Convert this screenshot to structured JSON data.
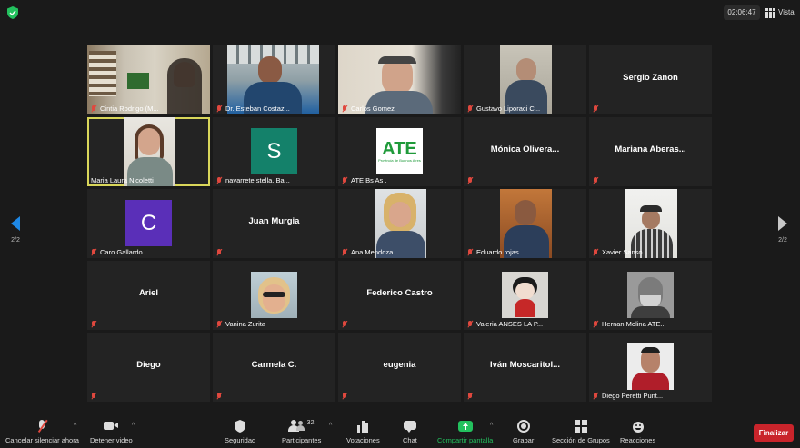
{
  "topbar": {
    "timer": "02:06:47",
    "view_label": "Vista"
  },
  "pager": {
    "left_page": "2/2",
    "right_page": "2/2"
  },
  "participants": [
    {
      "name": "Cintia Rodrigo (M...",
      "display": "video"
    },
    {
      "name": "Dr. Esteban Costaz...",
      "display": "video"
    },
    {
      "name": "Carlos Gomez",
      "display": "video"
    },
    {
      "name": "Gustavo Liporaci C...",
      "display": "video"
    },
    {
      "name": "",
      "display": "name",
      "center": "Sergio Zanon"
    },
    {
      "name": "Maria Laura Nicoletti",
      "display": "video",
      "active": true
    },
    {
      "name": "navarrete stella. Ba...",
      "display": "avatar",
      "initial": "S"
    },
    {
      "name": "ATE Bs As .",
      "display": "logo",
      "logo_text": "ATE",
      "logo_sub": "Provincia de Buenos Aires"
    },
    {
      "name": "",
      "display": "name",
      "center": "Mónica  Olivera..."
    },
    {
      "name": "",
      "display": "name",
      "center": "Mariana  Aberas..."
    },
    {
      "name": "Caro Gallardo",
      "display": "avatar",
      "initial": "C"
    },
    {
      "name": "",
      "display": "name",
      "center": "Juan Murgia"
    },
    {
      "name": "Ana Mendoza",
      "display": "video"
    },
    {
      "name": "Eduardo rojas",
      "display": "video"
    },
    {
      "name": "Xavier Sanso",
      "display": "video"
    },
    {
      "name": "",
      "display": "name",
      "center": "Ariel"
    },
    {
      "name": "Vanina Zurita",
      "display": "video"
    },
    {
      "name": "",
      "display": "name",
      "center": "Federico Castro"
    },
    {
      "name": "Valeria ANSES LA P...",
      "display": "video"
    },
    {
      "name": "Hernan Molina ATE...",
      "display": "video"
    },
    {
      "name": "",
      "display": "name",
      "center": "Diego"
    },
    {
      "name": "",
      "display": "name",
      "center": "Carmela C."
    },
    {
      "name": "",
      "display": "name",
      "center": "eugenia"
    },
    {
      "name": "",
      "display": "name",
      "center": "Iván  Moscaritol..."
    },
    {
      "name": "Diego Peretti Punt...",
      "display": "video"
    }
  ],
  "toolbar": {
    "unmute": "Cancelar silenciar ahora",
    "stop_video": "Detener video",
    "security": "Seguridad",
    "participants": "Participantes",
    "participants_count": "32",
    "polls": "Votaciones",
    "chat": "Chat",
    "share": "Compartir pantalla",
    "record": "Grabar",
    "breakout": "Sección de Grupos",
    "reactions": "Reacciones",
    "end": "Finalizar"
  },
  "colors": {
    "background": "#1a1a1a",
    "tile": "#232323",
    "active_border": "#d9d65a",
    "share_green": "#23c15e",
    "end_red": "#c9242b",
    "mic_muted": "#e0483e",
    "avatar_teal": "#14816a",
    "avatar_purple": "#5a2fb8"
  }
}
